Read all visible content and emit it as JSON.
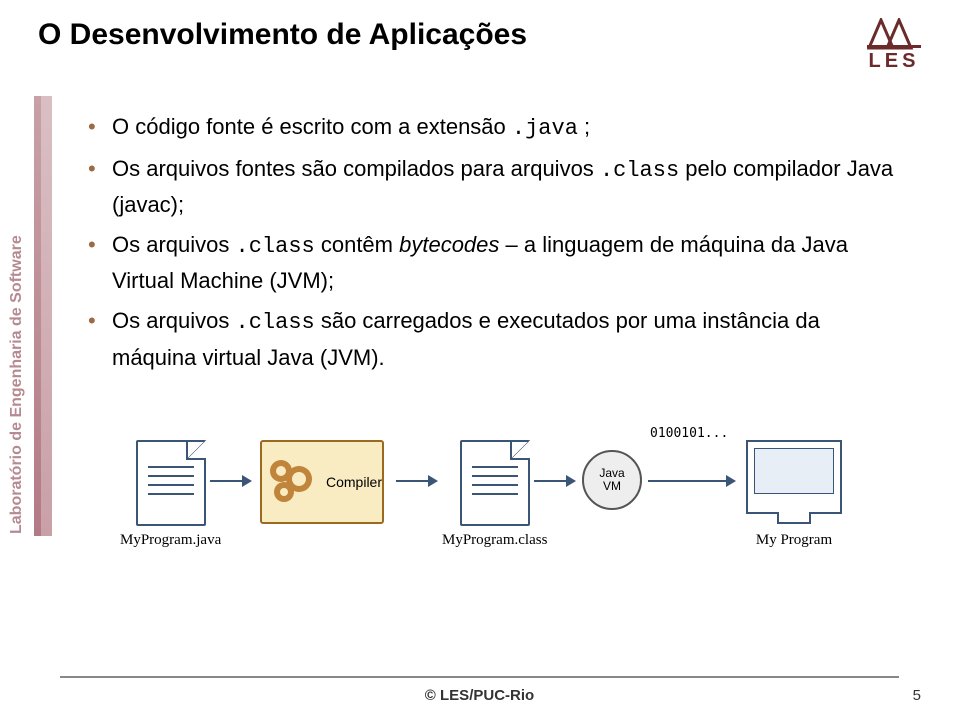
{
  "title": "O Desenvolvimento de Aplicações",
  "sidebar_text": "Laboratório de Engenharia de Software",
  "logo_text": "LES",
  "bullets": [
    {
      "pre": "O código fonte é escrito com a extensão",
      "code": ".java",
      "post": " ;"
    },
    {
      "pre": "Os arquivos fontes são compilados para arquivos",
      "code": ".class",
      "post": " pelo compilador Java (javac);"
    },
    {
      "pre": "Os arquivos",
      "code": ".class",
      "post_italic": "bytecodes",
      "post_rest": " – a linguagem de máquina da Java Virtual Machine (JVM);",
      "mid": " contêm "
    },
    {
      "pre": "Os arquivos",
      "code": ".class",
      "post": " são carregados e executados por uma instância da máquina virtual Java (JVM)."
    }
  ],
  "diagram": {
    "source_label": "MyProgram.java",
    "compiler_label": "Compiler",
    "class_label": "MyProgram.class",
    "jvm_top": "Java",
    "jvm_bottom": "VM",
    "bits": "0100101...",
    "output_label": "My Program"
  },
  "footer": {
    "center": "© LES/PUC-Rio",
    "page": "5"
  }
}
